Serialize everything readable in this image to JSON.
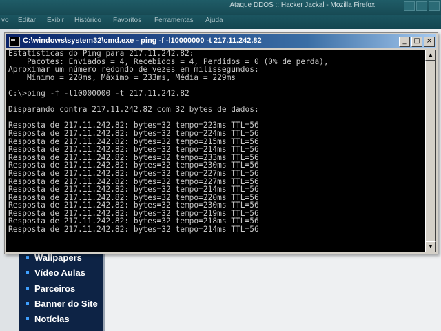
{
  "browser": {
    "title": "Ataque DDOS :: Hacker Jackal - Mozilla Firefox",
    "menu": [
      "vo",
      "Editar",
      "Exibir",
      "Histórico",
      "Favoritos",
      "Ferramentas",
      "Ajuda"
    ]
  },
  "site_nav": {
    "items": [
      "Wallpapers",
      "Vídeo Aulas",
      "Parceiros",
      "Banner do Site",
      "Notícias"
    ]
  },
  "cmd": {
    "title": "C:\\windows\\system32\\cmd.exe - ping -f -l10000000 -t 217.11.242.82",
    "lines": [
      "Estatísticas do Ping para 217.11.242.82:",
      "    Pacotes: Enviados = 4, Recebidos = 4, Perdidos = 0 (0% de perda),",
      "Aproximar um número redondo de vezes em milissegundos:",
      "    Mínimo = 220ms, Máximo = 233ms, Média = 229ms",
      "",
      "C:\\>ping -f -l10000000 -t 217.11.242.82",
      "",
      "Disparando contra 217.11.242.82 com 32 bytes de dados:",
      "",
      "Resposta de 217.11.242.82: bytes=32 tempo=223ms TTL=56",
      "Resposta de 217.11.242.82: bytes=32 tempo=224ms TTL=56",
      "Resposta de 217.11.242.82: bytes=32 tempo=215ms TTL=56",
      "Resposta de 217.11.242.82: bytes=32 tempo=214ms TTL=56",
      "Resposta de 217.11.242.82: bytes=32 tempo=233ms TTL=56",
      "Resposta de 217.11.242.82: bytes=32 tempo=230ms TTL=56",
      "Resposta de 217.11.242.82: bytes=32 tempo=227ms TTL=56",
      "Resposta de 217.11.242.82: bytes=32 tempo=227ms TTL=56",
      "Resposta de 217.11.242.82: bytes=32 tempo=214ms TTL=56",
      "Resposta de 217.11.242.82: bytes=32 tempo=220ms TTL=56",
      "Resposta de 217.11.242.82: bytes=32 tempo=230ms TTL=56",
      "Resposta de 217.11.242.82: bytes=32 tempo=219ms TTL=56",
      "Resposta de 217.11.242.82: bytes=32 tempo=218ms TTL=56",
      "Resposta de 217.11.242.82: bytes=32 tempo=214ms TTL=56"
    ],
    "buttons": {
      "minimize": "_",
      "maximize": "□",
      "close": "×"
    },
    "icon": "cmd-console-icon"
  },
  "colors": {
    "console_bg": "#000000",
    "console_text": "#c8c8c8",
    "titlebar": "#0a246a",
    "site_nav_bg": "#0d2345"
  }
}
